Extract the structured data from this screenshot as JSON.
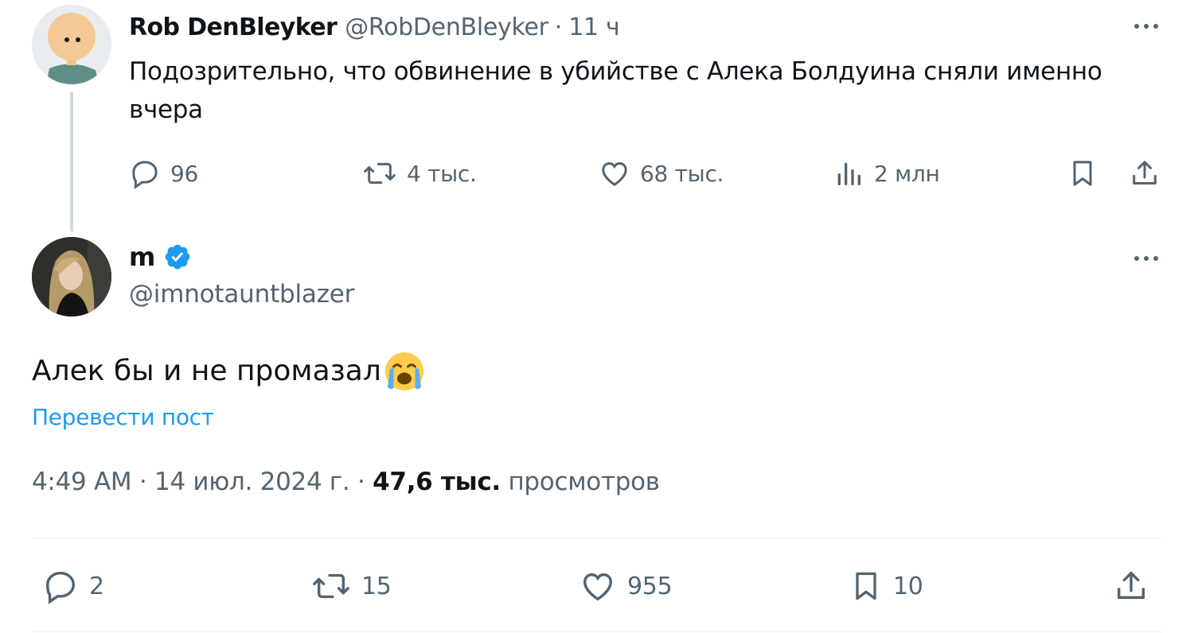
{
  "parent": {
    "author_name": "Rob DenBleyker",
    "handle": "@RobDenBleyker",
    "separator": "·",
    "time": "11 ч",
    "text": "Подозрительно, что обвинение в убийстве с Алека Болдуина сняли именно вчера",
    "actions": {
      "replies": "96",
      "reposts": "4 тыс.",
      "likes": "68 тыс.",
      "views": "2 млн"
    }
  },
  "reply": {
    "author_name": "m",
    "handle": "@imnotauntblazer",
    "text": "Алек бы и не промазал",
    "emoji": "loudly-crying-face",
    "translate_label": "Перевести пост",
    "time": "4:49 AM",
    "date": "14 июл. 2024 г.",
    "views_count": "47,6 тыс.",
    "views_label": "просмотров",
    "separator": "·",
    "actions": {
      "replies": "2",
      "reposts": "15",
      "likes": "955",
      "bookmarks": "10"
    }
  },
  "colors": {
    "text": "#0f1419",
    "secondary": "#536471",
    "link": "#1d9bf0",
    "verified": "#1d9bf0",
    "line": "#cfd9de"
  }
}
